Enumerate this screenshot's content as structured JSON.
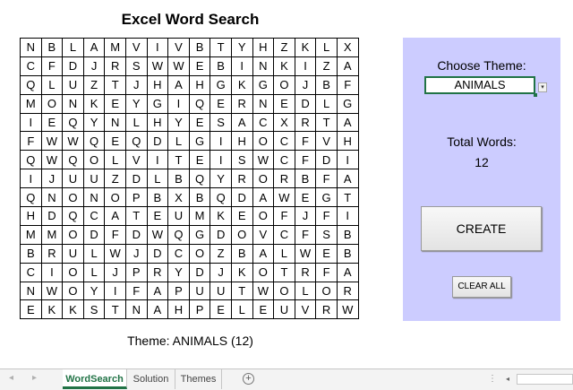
{
  "title": "Excel Word Search",
  "grid": [
    [
      "N",
      "B",
      "L",
      "A",
      "M",
      "V",
      "I",
      "V",
      "B",
      "T",
      "Y",
      "H",
      "Z",
      "K",
      "L",
      "X"
    ],
    [
      "C",
      "F",
      "D",
      "J",
      "R",
      "S",
      "W",
      "W",
      "E",
      "B",
      "I",
      "N",
      "K",
      "I",
      "Z",
      "A"
    ],
    [
      "Q",
      "L",
      "U",
      "Z",
      "T",
      "J",
      "H",
      "A",
      "H",
      "G",
      "K",
      "G",
      "O",
      "J",
      "B",
      "F"
    ],
    [
      "M",
      "O",
      "N",
      "K",
      "E",
      "Y",
      "G",
      "I",
      "Q",
      "E",
      "R",
      "N",
      "E",
      "D",
      "L",
      "G"
    ],
    [
      "I",
      "E",
      "Q",
      "Y",
      "N",
      "L",
      "H",
      "Y",
      "E",
      "S",
      "A",
      "C",
      "X",
      "R",
      "T",
      "A"
    ],
    [
      "F",
      "W",
      "W",
      "Q",
      "E",
      "Q",
      "D",
      "L",
      "G",
      "I",
      "H",
      "O",
      "C",
      "F",
      "V",
      "H"
    ],
    [
      "Q",
      "W",
      "Q",
      "O",
      "L",
      "V",
      "I",
      "T",
      "E",
      "I",
      "S",
      "W",
      "C",
      "F",
      "D",
      "I"
    ],
    [
      "I",
      "J",
      "U",
      "U",
      "Z",
      "D",
      "L",
      "B",
      "Q",
      "Y",
      "R",
      "O",
      "R",
      "B",
      "F",
      "A"
    ],
    [
      "Q",
      "N",
      "O",
      "N",
      "O",
      "P",
      "B",
      "X",
      "B",
      "Q",
      "D",
      "A",
      "W",
      "E",
      "G",
      "T"
    ],
    [
      "H",
      "D",
      "Q",
      "C",
      "A",
      "T",
      "E",
      "U",
      "M",
      "K",
      "E",
      "O",
      "F",
      "J",
      "F",
      "I"
    ],
    [
      "M",
      "M",
      "O",
      "D",
      "F",
      "D",
      "W",
      "Q",
      "G",
      "D",
      "O",
      "V",
      "C",
      "F",
      "S",
      "B"
    ],
    [
      "B",
      "R",
      "U",
      "L",
      "W",
      "J",
      "D",
      "C",
      "O",
      "Z",
      "B",
      "A",
      "L",
      "W",
      "E",
      "B"
    ],
    [
      "C",
      "I",
      "O",
      "L",
      "J",
      "P",
      "R",
      "Y",
      "D",
      "J",
      "K",
      "O",
      "T",
      "R",
      "F",
      "A"
    ],
    [
      "N",
      "W",
      "O",
      "Y",
      "I",
      "F",
      "A",
      "P",
      "U",
      "U",
      "T",
      "W",
      "O",
      "L",
      "O",
      "R"
    ],
    [
      "E",
      "K",
      "K",
      "S",
      "T",
      "N",
      "A",
      "H",
      "P",
      "E",
      "L",
      "E",
      "U",
      "V",
      "R",
      "W"
    ]
  ],
  "theme_caption": "Theme: ANIMALS (12)",
  "panel": {
    "choose_label": "Choose Theme:",
    "theme_value": "ANIMALS",
    "dropdown_icon": "▾",
    "total_label": "Total Words:",
    "total_value": "12",
    "create_label": "CREATE",
    "clear_label": "CLEAR ALL",
    "background": "#ccccff"
  },
  "tabs": [
    {
      "label": "WordSearch",
      "active": true
    },
    {
      "label": "Solution",
      "active": false
    },
    {
      "label": "Themes",
      "active": false
    }
  ],
  "tabbar": {
    "prev_icon": "◂",
    "next_icon": "▸",
    "add_icon": "+",
    "dots": "⋮",
    "scroll_left_icon": "◂"
  },
  "colors": {
    "accent": "#217346",
    "panel_bg": "#ccccff"
  }
}
